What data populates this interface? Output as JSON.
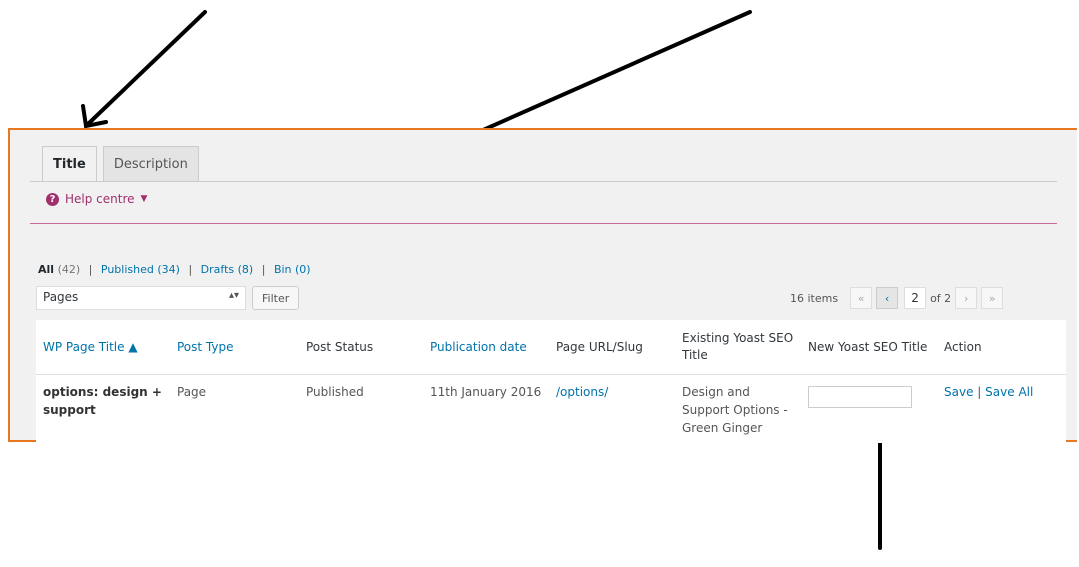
{
  "tabs": [
    {
      "label": "Title"
    },
    {
      "label": "Description"
    }
  ],
  "help": {
    "label": "Help centre",
    "icon": "question-circle-icon"
  },
  "views": {
    "all": {
      "label": "All",
      "count": "(42)"
    },
    "published": {
      "label": "Published",
      "count": "(34)"
    },
    "drafts": {
      "label": "Drafts",
      "count": "(8)"
    },
    "bin": {
      "label": "Bin",
      "count": "(0)"
    }
  },
  "filter": {
    "selected": "Pages",
    "button_label": "Filter"
  },
  "pagination": {
    "items": "16 items",
    "first": "«",
    "prev": "‹",
    "current": "2",
    "of_label": "of 2",
    "next": "›",
    "last": "»"
  },
  "table": {
    "headers": {
      "title": "WP Page Title ▲",
      "post_type": "Post Type",
      "post_status": "Post Status",
      "publication_date": "Publication date",
      "url": "Page URL/Slug",
      "existing": "Existing Yoast SEO Title",
      "new": "New Yoast SEO Title",
      "action": "Action"
    },
    "rows": [
      {
        "title": "options: design + support",
        "post_type": "Page",
        "post_status": "Published",
        "publication_date": "11th January 2016",
        "url": "/options/",
        "existing": "Design and Support Options - Green Ginger",
        "save": "Save",
        "separator": "|",
        "save_all": "Save All"
      }
    ]
  },
  "colors": {
    "frame_border": "#e87722",
    "help_accent": "#a0306e",
    "link": "#0073aa"
  }
}
